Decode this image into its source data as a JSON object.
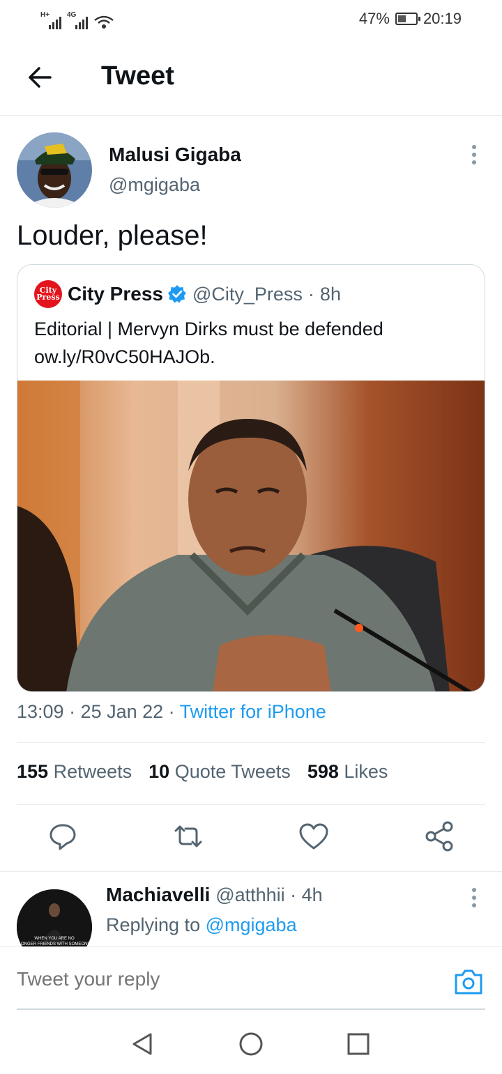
{
  "status_bar": {
    "signal1_tag": "H+",
    "signal2_tag": "4G",
    "wifi_icon": "wifi-icon",
    "battery_percent": "47%",
    "battery_level": 0.47,
    "time": "20:19"
  },
  "header": {
    "back_icon": "arrow-left-icon",
    "title": "Tweet"
  },
  "tweet": {
    "author_name": "Malusi Gigaba",
    "author_handle": "@mgigaba",
    "more_icon": "more-vertical-icon",
    "text": "Louder, please!",
    "quote": {
      "logo_text_top": "City",
      "logo_text_bottom": "Press",
      "name": "City Press",
      "verified_icon": "verified-badge-icon",
      "handle": "@City_Press",
      "separator": "·",
      "time": "8h",
      "text_line1": "Editorial | Mervyn Dirks must be defended",
      "text_line2": "ow.ly/R0vC50HAJOb."
    },
    "timestamp": "13:09 · 25 Jan 22 ·",
    "source": "Twitter for iPhone",
    "stats": {
      "retweets_count": "155",
      "retweets_label": "Retweets",
      "quotes_count": "10",
      "quotes_label": "Quote Tweets",
      "likes_count": "598",
      "likes_label": "Likes"
    },
    "actions": [
      "reply-icon",
      "retweet-icon",
      "like-icon",
      "share-icon"
    ]
  },
  "reply": {
    "name": "Machiavelli",
    "handle_time": "@atthhii · 4h",
    "replying_to_label": "Replying to",
    "replying_to_handle": "@mgigaba",
    "avatar_caption": "WHEN YOU ARE NO LONGER FRIENDS WITH SOMEONE"
  },
  "composer": {
    "placeholder": "Tweet your reply",
    "camera_icon": "camera-icon"
  },
  "nav": [
    "back-triangle-icon",
    "home-circle-icon",
    "recents-square-icon"
  ],
  "colors": {
    "accent": "#1d9bf0",
    "text_primary": "#0f1419",
    "text_secondary": "#536471",
    "border": "#e6ecf0",
    "city_press_red": "#e3141b"
  }
}
